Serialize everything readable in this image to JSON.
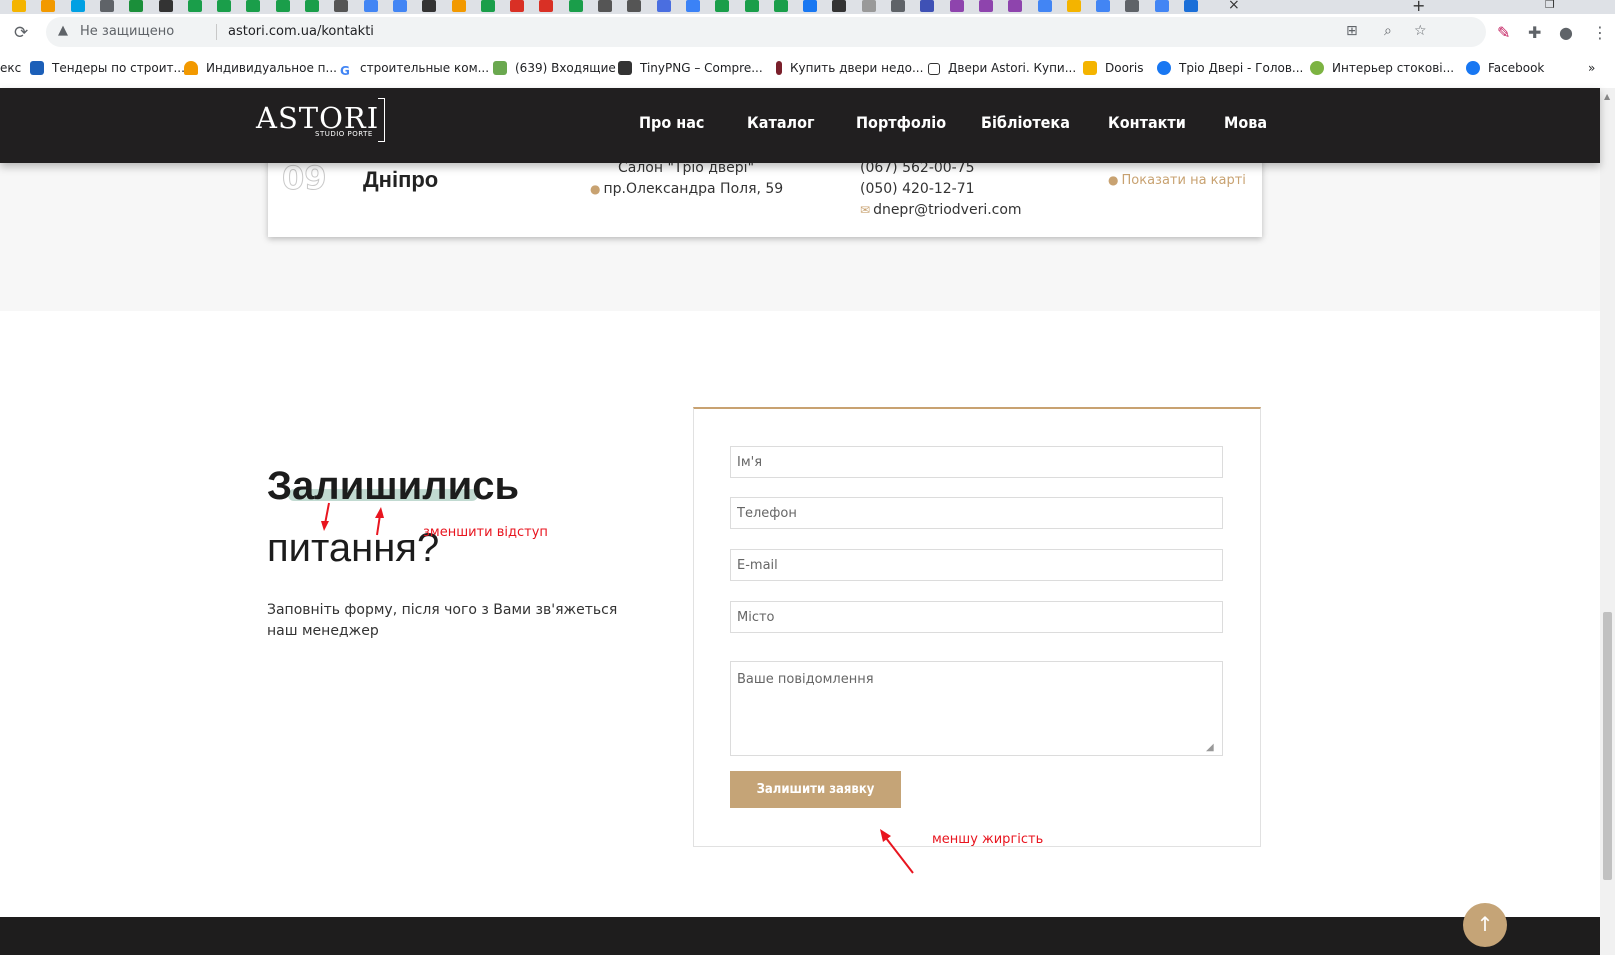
{
  "browser": {
    "tab_icon_colors": [
      "#f4b400",
      "#f29900",
      "#00a0e3",
      "#5f6368",
      "#1b8f3a",
      "#333333",
      "#1a9e4a",
      "#1a9e4a",
      "#1a9e4a",
      "#1a9e4a",
      "#1a9e4a",
      "#555555",
      "#4285f4",
      "#4285f4",
      "#333333",
      "#f29900",
      "#1a9e4a",
      "#d93025",
      "#d93025",
      "#1a9e4a",
      "#555555",
      "#555555",
      "#4a6ee0",
      "#3b82f6",
      "#1a9e4a",
      "#1a9e4a",
      "#1a9e4a",
      "#1877f2",
      "#333333",
      "#999999",
      "#5f6368",
      "#3f51b5",
      "#8e44ad",
      "#8e44ad",
      "#8e44ad",
      "#4285f4",
      "#f4b400",
      "#4285f4",
      "#5f6368",
      "#4285f4",
      "#1b6fd8"
    ],
    "active_tab_close": "×",
    "new_tab": "+",
    "restore": "❐",
    "security_label": "Не защищено",
    "url": "astori.com.ua/kontakti",
    "omnibox_icons": [
      "translate-icon",
      "zoom-icon",
      "star-icon"
    ],
    "toolbar_icons": [
      "extension-pen-icon",
      "puzzle-icon",
      "profile-icon",
      "menu-icon"
    ]
  },
  "bookmarks": [
    {
      "label": "екс",
      "color": "#ffffff"
    },
    {
      "label": "Тендеры по строит...",
      "color": "#1c5fb8"
    },
    {
      "label": "Индивидуальное п...",
      "color": "#f29900"
    },
    {
      "label": "строительные ком...",
      "color": "#4285f4"
    },
    {
      "label": "(639) Входящие",
      "color": "#6aa84f"
    },
    {
      "label": "TinyPNG – Compre...",
      "color": "#333333"
    },
    {
      "label": "Купить двери недо...",
      "color": "#7a1f2b"
    },
    {
      "label": "Двери Astori. Купи...",
      "color": "#333333"
    },
    {
      "label": "Dooris",
      "color": "#f4b400"
    },
    {
      "label": "Тріо Двері - Голов...",
      "color": "#1877f2"
    },
    {
      "label": "Интерьер стокові...",
      "color": "#7cb342"
    },
    {
      "label": "Facebook",
      "color": "#1877f2"
    },
    {
      "label": "»",
      "color": "#ffffff"
    }
  ],
  "site": {
    "logo": {
      "text": "ASTORI",
      "sub": "STUDIO PORTE"
    },
    "nav": [
      "Про нас",
      "Каталог",
      "Портфоліо",
      "Бібліотека",
      "Контакти",
      "Мова"
    ],
    "city_card": {
      "number": "09",
      "city": "Дніпро",
      "salon": "Салон \"Тріо двері\"",
      "address": "пр.Олександра Поля, 59",
      "phone1": "(067) 562-00-75",
      "phone2": "(050) 420-12-71",
      "email": "dnepr@triodveri.com",
      "map_link": "Показати на карті"
    },
    "form": {
      "title_line1": "Залишились",
      "title_line2": "питання?",
      "description": "Заповніть форму, після чого з Вами зв'яжеться наш менеджер",
      "name_placeholder": "Ім'я",
      "phone_placeholder": "Телефон",
      "email_placeholder": "E-mail",
      "city_placeholder": "Місто",
      "message_placeholder": "Ваше повідомлення",
      "submit_label": "Залишити заявку"
    },
    "annotations": {
      "spacing_note": "зменшити відступ",
      "weight_note": "меншу жиргість",
      "color": "#e8151f"
    },
    "accent_color": "#c5a477",
    "scroll_top_icon": "↑"
  }
}
